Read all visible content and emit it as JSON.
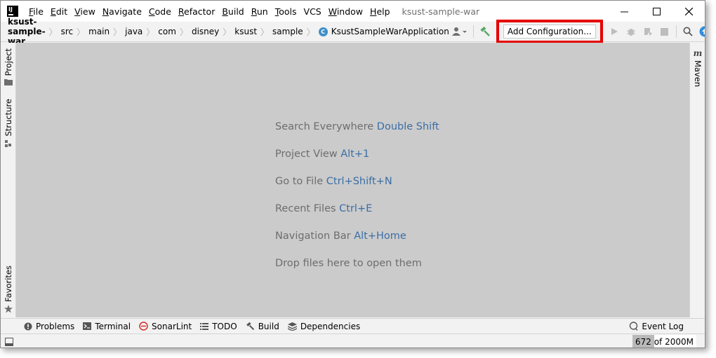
{
  "menu": {
    "items": [
      {
        "label": "File",
        "mnemonic": "F",
        "rest": "ile"
      },
      {
        "label": "Edit",
        "mnemonic": "E",
        "rest": "dit"
      },
      {
        "label": "View",
        "mnemonic": "V",
        "rest": "iew"
      },
      {
        "label": "Navigate",
        "mnemonic": "N",
        "rest": "avigate"
      },
      {
        "label": "Code",
        "mnemonic": "C",
        "rest": "ode"
      },
      {
        "label": "Refactor",
        "mnemonic": "R",
        "rest": "efactor"
      },
      {
        "label": "Build",
        "mnemonic": "B",
        "rest": "uild"
      },
      {
        "label": "Run",
        "mnemonic": "R",
        "rest": "un"
      },
      {
        "label": "Tools",
        "mnemonic": "T",
        "rest": "ools"
      },
      {
        "label": "VCS",
        "mnemonic": "",
        "rest": "VCS"
      },
      {
        "label": "Window",
        "mnemonic": "W",
        "rest": "indow"
      },
      {
        "label": "Help",
        "mnemonic": "H",
        "rest": "elp"
      }
    ]
  },
  "window": {
    "title": "ksust-sample-war",
    "logo_text": "IJ"
  },
  "breadcrumbs": [
    {
      "label": "ksust-sample-war",
      "bold": true
    },
    {
      "label": "src"
    },
    {
      "label": "main"
    },
    {
      "label": "java"
    },
    {
      "label": "com"
    },
    {
      "label": "disney"
    },
    {
      "label": "ksust"
    },
    {
      "label": "sample"
    },
    {
      "label": "KsustSampleWarApplication",
      "class_icon": true
    }
  ],
  "toolbar": {
    "add_configuration_label": "Add Configuration...",
    "highlight_color": "#e60000",
    "icons": [
      "user-icon",
      "hammer-icon",
      "run-icon",
      "debug-icon",
      "coverage-icon",
      "stop-icon",
      "search-icon",
      "update-icon",
      "toolbox-icon"
    ]
  },
  "left_tabs": {
    "project": "Project",
    "structure": "Structure",
    "favorites": "Favorites"
  },
  "right_tabs": {
    "maven": "Maven"
  },
  "editor_hints": [
    {
      "text": "Search Everywhere ",
      "key": "Double Shift"
    },
    {
      "text": "Project View ",
      "key": "Alt+1"
    },
    {
      "text": "Go to File ",
      "key": "Ctrl+Shift+N"
    },
    {
      "text": "Recent Files ",
      "key": "Ctrl+E"
    },
    {
      "text": "Navigation Bar ",
      "key": "Alt+Home"
    },
    {
      "text": "Drop files here to open them",
      "key": ""
    }
  ],
  "bottom_tabs": {
    "problems": "Problems",
    "terminal": "Terminal",
    "sonarlint": "SonarLint",
    "todo": "TODO",
    "build": "Build",
    "dependencies": "Dependencies",
    "event_log": "Event Log"
  },
  "status": {
    "memory_used": "672",
    "memory_total": " of 2000M"
  }
}
